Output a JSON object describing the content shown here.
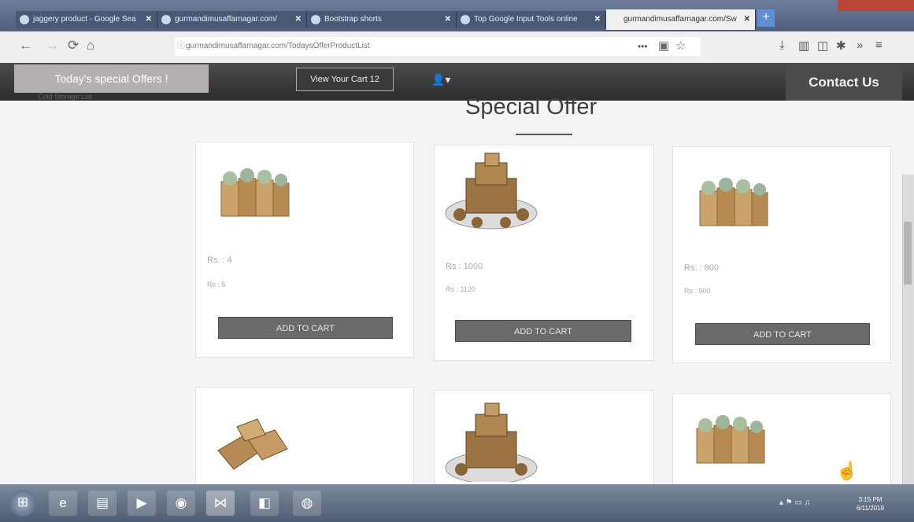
{
  "browser": {
    "tabs": [
      {
        "label": "jaggery product - Google Sea"
      },
      {
        "label": "gurmandimusaffarnagar.com/"
      },
      {
        "label": "Bootstrap shorts"
      },
      {
        "label": "Top Google Input Tools online"
      },
      {
        "label": "gurmandimusaffarnagar.com/Sw"
      }
    ],
    "new_tab": "+",
    "url": "gurmandimusaffarnagar.com/TodaysOfferProductList",
    "url_dots": "•••"
  },
  "site": {
    "offers_label": "Today's special Offers !",
    "cart_label": "View Your Cart 12",
    "contact_label": "Contact Us",
    "storage_label": "Cold Storage List",
    "heading": "Special Offer",
    "add_label": "ADD TO CART",
    "products": [
      {
        "price": "Rs. : 4",
        "old": "Rs : 5"
      },
      {
        "price": "Rs : 1000",
        "old": "Rs : 1120"
      },
      {
        "price": "Rs. : 800",
        "old": "Rs : 900"
      }
    ]
  },
  "taskbar": {
    "clock_time": "3:15 PM",
    "clock_date": "6/11/2019"
  }
}
